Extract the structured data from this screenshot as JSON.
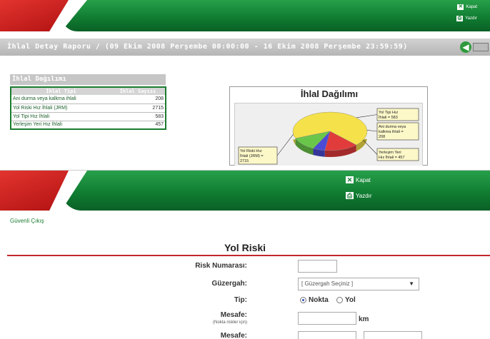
{
  "report_screen": {
    "toolbar": {
      "close_label": "Kapat",
      "print_label": "Yazdır"
    },
    "title": "İhlal Detay Raporu / (09 Ekim 2008 Perşembe 00:00:00 - 16 Ekim 2008 Perşembe 23:59:59)",
    "section_title": "İhlal Dağılımı",
    "table": {
      "headers": [
        "İhlal Tipi",
        "İhlal Sayısı"
      ],
      "rows": [
        {
          "type": "Ani durma veya kalkma ihlali",
          "count": "208"
        },
        {
          "type": "Yol Riski Hız İhlali (JRM)",
          "count": "2715"
        },
        {
          "type": "Yol Tipi Hız İhlali",
          "count": "583"
        },
        {
          "type": "Yerleşim Yeri Hız İhlali",
          "count": "457"
        }
      ]
    },
    "chart_data": {
      "type": "pie",
      "title": "İhlal Dağılımı",
      "categories": [
        "Yol Riski Hız İhlali (JRM)",
        "Yol Tipi Hız İhlali",
        "Ani durma veya kalkma ihlali",
        "Yerleşim Yeri Hız İhlali"
      ],
      "values": [
        2715,
        583,
        208,
        457
      ],
      "colors": [
        "#f5e14a",
        "#e23b3b",
        "#4b4bd6",
        "#6ac64a"
      ],
      "labels": [
        "Yol Riski Hız İhlali (JRM) = 2715",
        "Yol Tipi Hız İhlali = 583",
        "Ani durma veya kalkma ihlali = 208",
        "Yerleşim Yeri Hız İhlali = 457"
      ],
      "label_lines": [
        [
          "Yol Riski Hız",
          "İhlali (JRM) =",
          "2715"
        ],
        [
          "Yol Tipi Hız",
          "İhlali = 583"
        ],
        [
          "Ani durma veya",
          "kalkma ihlali =",
          "208"
        ],
        [
          "Yerleşim Yeri",
          "Hız İhlali = 457"
        ]
      ]
    }
  },
  "form_screen": {
    "toolbar": {
      "close_label": "Kapat",
      "print_label": "Yazdır"
    },
    "logout_link": "Güvenli Çıkış",
    "title": "Yol Riski",
    "fields": {
      "risk_number_label": "Risk Numarası:",
      "route_label": "Güzergah:",
      "route_value": "[ Güzergah Seçiniz ]",
      "type_label": "Tip:",
      "type_option_point": "Nokta",
      "type_option_road": "Yol",
      "type_selected": "Nokta",
      "distance_label": "Mesafe:",
      "distance_note": "(Nokta riskler için)",
      "distance_unit": "km",
      "distance2_label": "Mesafe:"
    }
  }
}
